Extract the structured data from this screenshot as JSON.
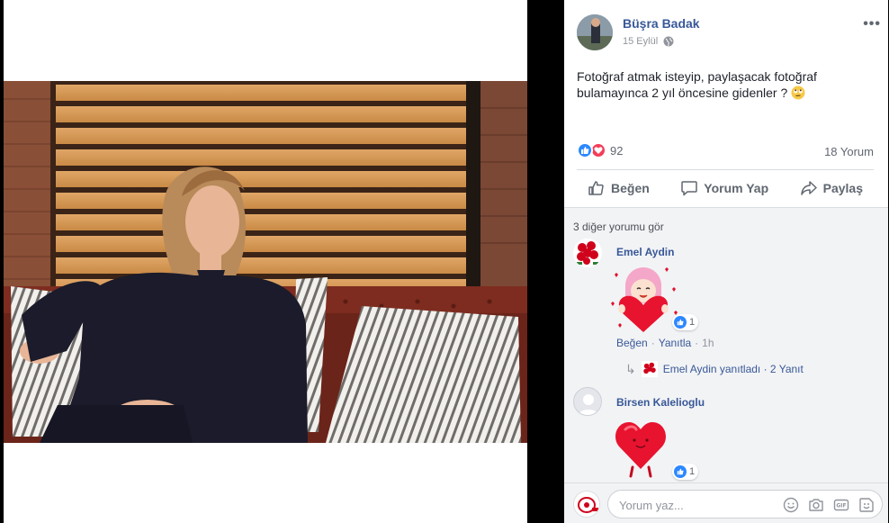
{
  "post": {
    "author": "Büşra Badak",
    "date": "15 Eylül",
    "privacy_icon": "globe-icon",
    "more_icon": "more-icon",
    "text": "Fotoğraf atmak isteyip, paylaşacak fotoğraf bulamayınca 2 yıl öncesine gidenler ?"
  },
  "stats": {
    "reactions_count": "92",
    "comments_count": "18 Yorum"
  },
  "actions": {
    "like": "Beğen",
    "comment": "Yorum Yap",
    "share": "Paylaş"
  },
  "comments_section": {
    "see_more": "3 diğer yorumu gör",
    "items": [
      {
        "name": "Emel Aydin",
        "sticker": "pink-hair-girl-heart-sticker",
        "reactions": "1",
        "like_label": "Beğen",
        "reply_label": "Yanıtla",
        "time": "1h",
        "reply_summary": "Emel Aydin yanıtladı · 2 Yanıt"
      },
      {
        "name": "Birsen Kalelioglu",
        "sticker": "red-heart-character-sticker",
        "reactions": "1"
      }
    ]
  },
  "composer": {
    "placeholder": "Yorum yaz..."
  },
  "colors": {
    "link": "#385898",
    "like_blue": "#2d88ff",
    "love_red": "#f33e58"
  }
}
